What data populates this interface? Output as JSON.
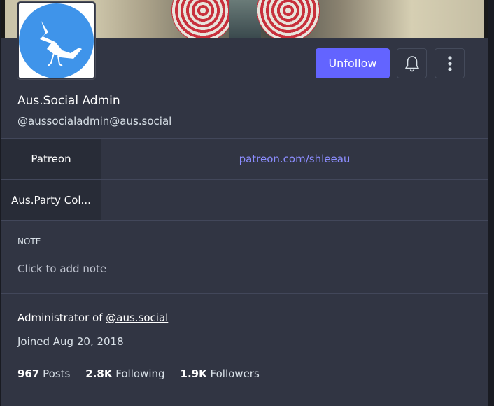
{
  "profile": {
    "display_name": "Aus.Social Admin",
    "acct": "@aussocialadmin@aus.social",
    "avatar_icon": "bird-logo-icon",
    "brand_color": "#3f94ea"
  },
  "actions": {
    "unfollow_label": "Unfollow",
    "bell_icon": "bell-icon",
    "more_icon": "vertical-ellipsis-icon",
    "accent": "#6364ff"
  },
  "fields": [
    {
      "name": "Patreon",
      "value": "patreon.com/shleeau"
    },
    {
      "name": "Aus.Party Col...",
      "value": ""
    }
  ],
  "note": {
    "label": "NOTE",
    "placeholder": "Click to add note"
  },
  "about": {
    "admin_prefix": "Administrator of ",
    "admin_link": "@aus.social",
    "joined": "Joined Aug 20, 2018"
  },
  "counts": {
    "posts_value": "967",
    "posts_label": "Posts",
    "following_value": "2.8K",
    "following_label": "Following",
    "followers_value": "1.9K",
    "followers_label": "Followers"
  }
}
